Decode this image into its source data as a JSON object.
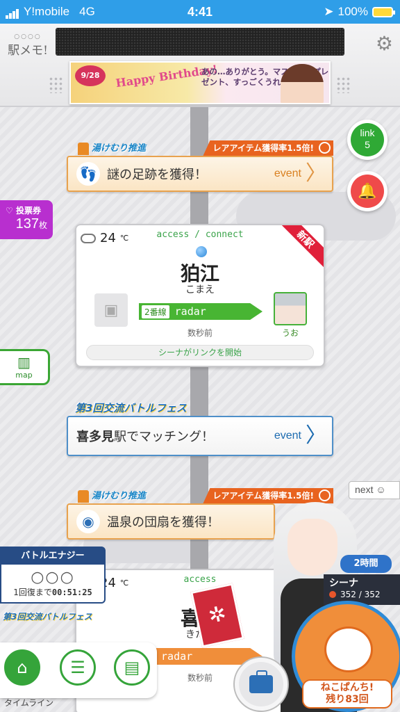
{
  "status_bar": {
    "carrier": "Y!mobile",
    "network": "4G",
    "time": "4:41",
    "battery": "100%"
  },
  "header": {
    "logo": "駅メモ!",
    "banner": {
      "date": "9/28",
      "title": "Happy Birthday!",
      "message": "あの…ありがとう。マスターのプレゼント、すっごくうれしい。"
    }
  },
  "side": {
    "vote_label": "投票券",
    "vote_count": "137",
    "vote_unit": "枚",
    "map_label": "map",
    "link_label": "link",
    "link_count": "5",
    "next_label": "next"
  },
  "timeline": [
    {
      "tag_left": "湯けむり推進",
      "tag_right": "レアアイテム獲得率1.5倍!",
      "text": "謎の足跡を獲得！",
      "kind": "event"
    },
    {
      "tag_left": "第3回交流バトルフェス",
      "station": "喜多見",
      "text": "駅でマッチング！",
      "kind": "event"
    },
    {
      "tag_left": "湯けむり推進",
      "tag_right": "レアアイテム獲得率1.5倍!",
      "text": "温泉の団扇を獲得！"
    }
  ],
  "station_card": {
    "temp": "24",
    "access": "access / connect",
    "new_badge": "新駅",
    "name": "狛江",
    "kana": "こまえ",
    "track": "2番線",
    "denko_track": "radar",
    "chara_name": "うお",
    "ago": "数秒前",
    "link_msg": "シーナがリンクを開始"
  },
  "station_card2": {
    "temp": "24",
    "access": "access",
    "name": "喜多",
    "kana": "きたみ",
    "denko_track": "radar",
    "ago": "数秒前",
    "fest": "第3回交流バトルフェス"
  },
  "energy": {
    "title": "バトルエナジー",
    "circles": "○○○",
    "recover_label": "1回復まで",
    "recover_time": "00:51:25"
  },
  "character": {
    "time_badge": "2時間",
    "name": "シーナ",
    "hp": "352 / 352"
  },
  "punch": {
    "line1": "ねこぱんち!",
    "line2": "残り83回"
  },
  "nav": {
    "timeline_label": "タイムライン"
  }
}
